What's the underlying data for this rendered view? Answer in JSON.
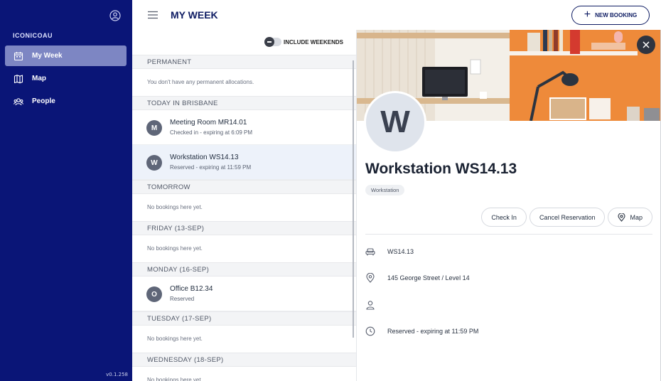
{
  "sidebar": {
    "org_name": "ICONICOAU",
    "items": [
      {
        "label": "My Week",
        "icon": "calendar-icon",
        "active": true
      },
      {
        "label": "Map",
        "icon": "map-icon",
        "active": false
      },
      {
        "label": "People",
        "icon": "people-icon",
        "active": false
      }
    ],
    "version": "v0.1.258"
  },
  "header": {
    "title": "MY WEEK",
    "new_booking_label": "NEW BOOKING"
  },
  "list": {
    "toggle_label": "INCLUDE WEEKENDS",
    "sections": [
      {
        "heading": "PERMANENT",
        "empty": "You don't have any permanent allocations."
      },
      {
        "heading": "TODAY IN BRISBANE",
        "items": [
          {
            "initial": "M",
            "title": "Meeting Room MR14.01",
            "subtitle": "Checked in - expiring at 6:09 PM"
          },
          {
            "initial": "W",
            "title": "Workstation WS14.13",
            "subtitle": "Reserved - expiring at 11:59 PM"
          }
        ]
      },
      {
        "heading": "TOMORROW",
        "empty": "No bookings here yet."
      },
      {
        "heading": "FRIDAY (13-SEP)",
        "empty": "No bookings here yet."
      },
      {
        "heading": "MONDAY (16-SEP)",
        "items": [
          {
            "initial": "O",
            "title": "Office B12.34",
            "subtitle": "Reserved"
          }
        ]
      },
      {
        "heading": "TUESDAY (17-SEP)",
        "empty": "No bookings here yet."
      },
      {
        "heading": "WEDNESDAY (18-SEP)",
        "empty": "No bookings here yet."
      }
    ]
  },
  "detail": {
    "initial": "W",
    "title": "Workstation WS14.13",
    "type_chip": "Workstation",
    "actions": {
      "check_in": "Check In",
      "cancel": "Cancel Reservation",
      "map": "Map"
    },
    "info": {
      "desk": "WS14.13",
      "address": "145 George Street / Level 14",
      "person": "",
      "status": "Reserved - expiring at 11:59 PM"
    }
  },
  "colors": {
    "sidebar_bg": "#0a1577",
    "accent": "#0e1c63",
    "active_nav": "#7d86c3"
  }
}
